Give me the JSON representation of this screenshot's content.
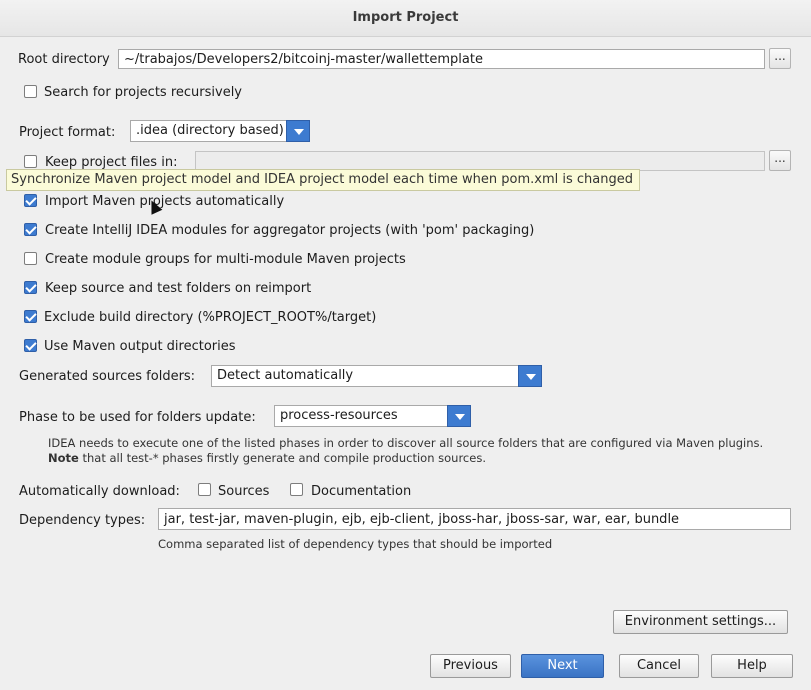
{
  "window": {
    "title": "Import Project"
  },
  "root_directory": {
    "label": "Root directory",
    "value": "~/trabajos/Developers2/bitcoinj-master/wallettemplate",
    "browse": "..."
  },
  "search_recursively": {
    "label": "Search for projects recursively",
    "checked": false
  },
  "project_format": {
    "label": "Project format:",
    "value": ".idea (directory based)"
  },
  "keep_project_files": {
    "label": "Keep project files in:",
    "checked": false,
    "value": "",
    "browse": "..."
  },
  "tooltip": {
    "text": "Synchronize Maven project model and IDEA project model each time when pom.xml is changed"
  },
  "options": [
    {
      "label": "Import Maven projects automatically",
      "checked": true
    },
    {
      "label": "Create IntelliJ IDEA modules for aggregator projects (with 'pom' packaging)",
      "checked": true
    },
    {
      "label": "Create module groups for multi-module Maven projects",
      "checked": false
    },
    {
      "label": "Keep source and test folders on reimport",
      "checked": true
    },
    {
      "label": "Exclude build directory (%PROJECT_ROOT%/target)",
      "checked": true
    },
    {
      "label": "Use Maven output directories",
      "checked": true
    }
  ],
  "generated_sources": {
    "label": "Generated sources folders:",
    "value": "Detect automatically"
  },
  "phase": {
    "label": "Phase to be used for folders update:",
    "value": "process-resources",
    "note_line1": "IDEA needs to execute one of the listed phases in order to discover all source folders that are configured via Maven plugins.",
    "note_bold": "Note",
    "note_line2": " that all test-* phases firstly generate and compile production sources."
  },
  "auto_download": {
    "label": "Automatically download:",
    "sources": {
      "label": "Sources",
      "checked": false
    },
    "documentation": {
      "label": "Documentation",
      "checked": false
    }
  },
  "dependency_types": {
    "label": "Dependency types:",
    "value": "jar, test-jar, maven-plugin, ejb, ejb-client, jboss-har, jboss-sar, war, ear, bundle",
    "hint": "Comma separated list of dependency types that should be imported"
  },
  "buttons": {
    "environment": "Environment settings...",
    "previous": "Previous",
    "next": "Next",
    "cancel": "Cancel",
    "help": "Help"
  }
}
